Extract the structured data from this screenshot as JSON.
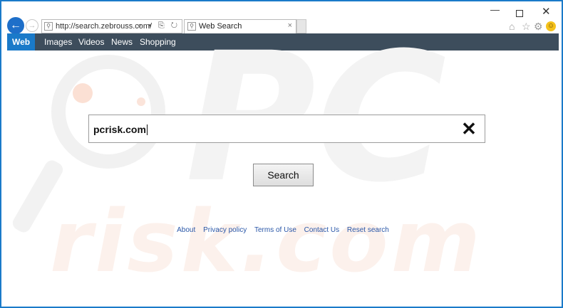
{
  "browser": {
    "url": "http://search.zebrouss.com/",
    "tab_title": "Web Search",
    "tab_close": "×",
    "address_tools": "⌕ ▾ ⎘ ↻",
    "window_controls": {
      "minimize": "—",
      "close": "✕"
    },
    "icons": {
      "back": "arrow-left-icon",
      "forward": "arrow-right-icon",
      "home": "home-icon",
      "favorites": "star-icon",
      "settings": "gear-icon",
      "feedback": "smiley-icon"
    }
  },
  "nav": {
    "items": [
      {
        "label": "Web",
        "active": true
      },
      {
        "label": "Images",
        "active": false
      },
      {
        "label": "Videos",
        "active": false
      },
      {
        "label": "News",
        "active": false
      },
      {
        "label": "Shopping",
        "active": false
      }
    ]
  },
  "search": {
    "value": "pcrisk.com",
    "clear_glyph": "✕",
    "button_label": "Search"
  },
  "footer": {
    "links": [
      "About",
      "Privacy policy",
      "Terms of Use",
      "Contact Us",
      "Reset search"
    ]
  },
  "watermark": {
    "top": "PC",
    "bottom": "risk.com"
  },
  "colors": {
    "frame": "#1a7ac9",
    "nav_bg": "#3d4d5c",
    "nav_active": "#1a7ac9",
    "link": "#2a57a8"
  }
}
